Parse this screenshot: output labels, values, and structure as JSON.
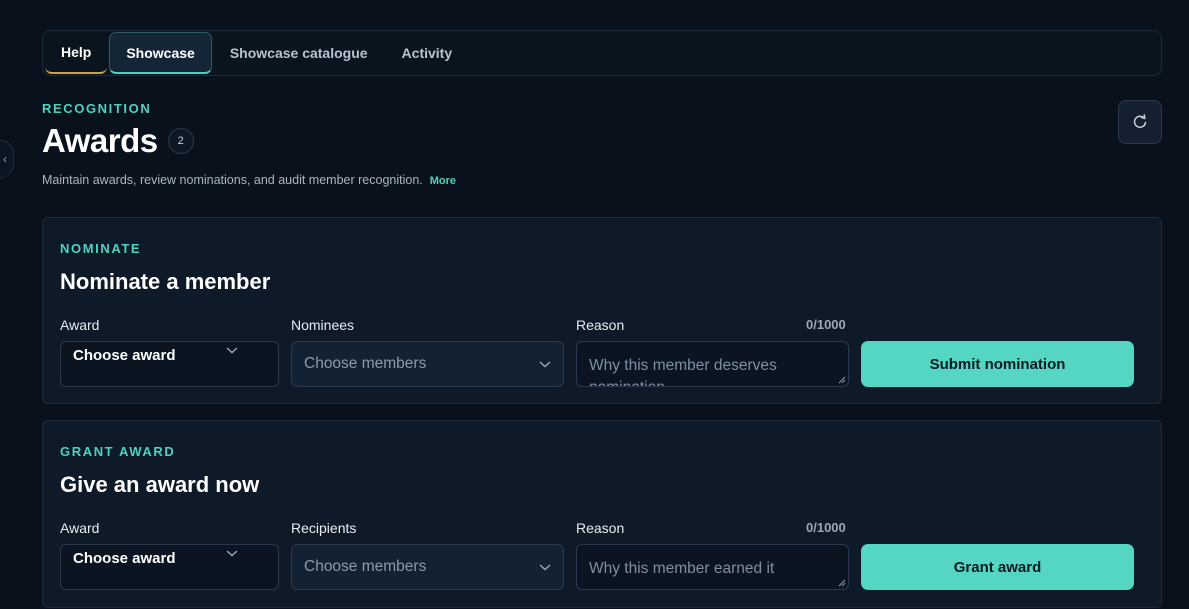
{
  "tabs": [
    {
      "label": "Help"
    },
    {
      "label": "Showcase"
    },
    {
      "label": "Showcase catalogue"
    },
    {
      "label": "Activity"
    }
  ],
  "active_tab": "Showcase",
  "header": {
    "eyebrow": "RECOGNITION",
    "title": "Awards",
    "count": "2",
    "subtitle": "Maintain awards, review nominations, and audit member recognition.",
    "more_label": "More",
    "refresh_icon": "refresh-icon"
  },
  "nominate": {
    "eyebrow": "NOMINATE",
    "title": "Nominate a member",
    "award_label": "Award",
    "award_value": "Choose award",
    "members_label": "Nominees",
    "members_placeholder": "Choose members",
    "reason_label": "Reason",
    "reason_counter": "0/1000",
    "reason_placeholder": "Why this member deserves nomination",
    "submit_label": "Submit nomination"
  },
  "grant": {
    "eyebrow": "GRANT AWARD",
    "title": "Give an award now",
    "award_label": "Award",
    "award_value": "Choose award",
    "members_label": "Recipients",
    "members_placeholder": "Choose members",
    "reason_label": "Reason",
    "reason_counter": "0/1000",
    "reason_placeholder": "Why this member earned it",
    "submit_label": "Grant award"
  },
  "colors": {
    "accent": "#4fd1c0",
    "button": "#55d6c2",
    "background": "#08111c",
    "card": "#0e1a28"
  }
}
